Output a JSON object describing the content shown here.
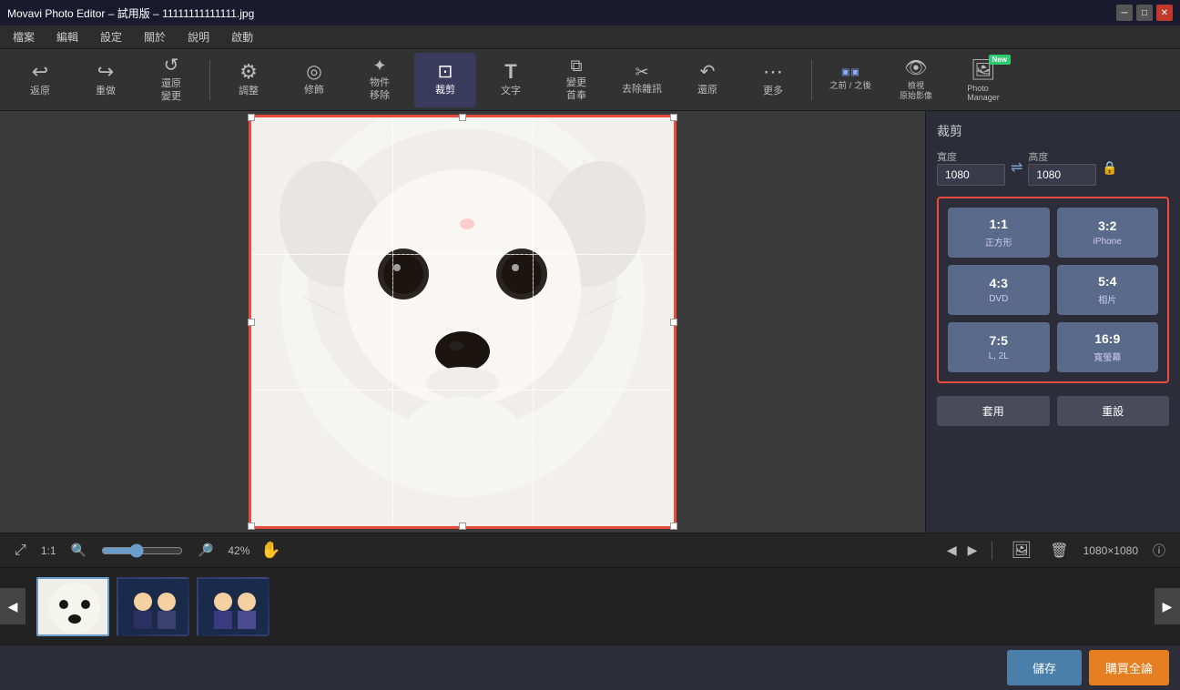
{
  "titleBar": {
    "title": "Movavi Photo Editor – 試用版 – 11111111111111.jpg",
    "controls": [
      "─",
      "□",
      "✕"
    ]
  },
  "menuBar": {
    "items": [
      "檔案",
      "編輯",
      "設定",
      "關於",
      "說明",
      "啟動"
    ]
  },
  "toolbar": {
    "buttons": [
      {
        "id": "undo",
        "icon": "↩",
        "label": "返原"
      },
      {
        "id": "redo",
        "icon": "↪",
        "label": "重做"
      },
      {
        "id": "restore",
        "icon": "↺",
        "label": "還原\n變更"
      },
      {
        "id": "adjust",
        "icon": "⚙",
        "label": "調整"
      },
      {
        "id": "retouch",
        "icon": "◎",
        "label": "修飾"
      },
      {
        "id": "erase",
        "icon": "✦",
        "label": "物件\n移除"
      },
      {
        "id": "crop",
        "icon": "⊡",
        "label": "裁剪"
      },
      {
        "id": "text",
        "icon": "T",
        "label": "文字"
      },
      {
        "id": "transform",
        "icon": "⧉",
        "label": "變更\n首奉"
      },
      {
        "id": "denoise",
        "icon": "✂",
        "label": "去除雜訊"
      },
      {
        "id": "restore2",
        "icon": "↶",
        "label": "還原"
      },
      {
        "id": "more",
        "icon": "⋯",
        "label": "更多"
      },
      {
        "id": "beforeafter",
        "label": "之前 / 之後"
      },
      {
        "id": "original",
        "icon": "👁",
        "label": "檢視\n原始影像"
      },
      {
        "id": "photomanager",
        "label": "Photo\nManager",
        "badge": "New"
      }
    ]
  },
  "rightPanel": {
    "title": "裁剪",
    "widthLabel": "寬度",
    "heightLabel": "高度",
    "widthValue": "1080",
    "heightValue": "1080",
    "ratioOptions": [
      {
        "ratio": "1:1",
        "name": "正方形"
      },
      {
        "ratio": "3:2",
        "name": "iPhone"
      },
      {
        "ratio": "4:3",
        "name": "DVD"
      },
      {
        "ratio": "5:4",
        "name": "相片"
      },
      {
        "ratio": "7:5",
        "name": "L, 2L"
      },
      {
        "ratio": "16:9",
        "name": "寬螢幕"
      }
    ],
    "applyLabel": "套用",
    "resetLabel": "重設"
  },
  "statusBar": {
    "zoomLabel": "42%",
    "ratio": "1:1",
    "dimensions": "1080×1080",
    "infoIcon": "ⓘ"
  },
  "filmstrip": {
    "navLeft": "◀",
    "navRight": "▶",
    "items": [
      {
        "id": "thumb1",
        "type": "dog",
        "active": true
      },
      {
        "id": "thumb2",
        "type": "people1",
        "active": false
      },
      {
        "id": "thumb3",
        "type": "people2",
        "active": false
      }
    ]
  },
  "bottomBar": {
    "saveLabel": "儲存",
    "buyLabel": "購買全論"
  }
}
